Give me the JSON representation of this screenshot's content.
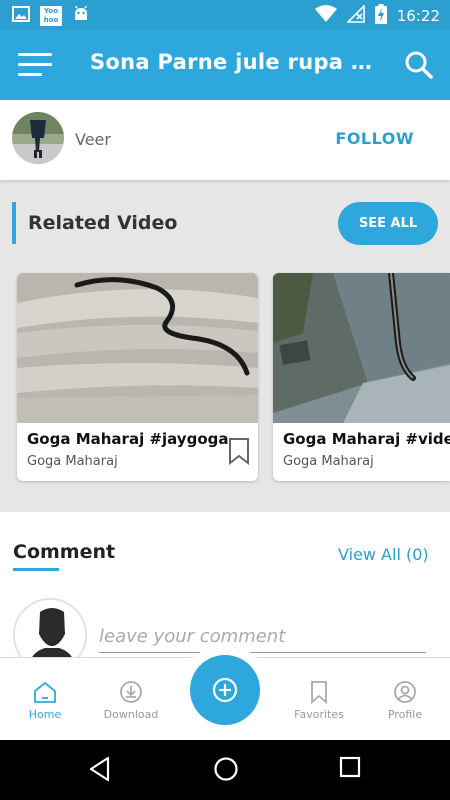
{
  "status_bar": {
    "time": "16:22",
    "left_icons": [
      "image-icon",
      "yoohoo-app-icon",
      "android-icon"
    ],
    "yoohoo_text": "Yoo hoo",
    "right_icons": [
      "wifi-icon",
      "no-signal-icon",
      "battery-charging-icon"
    ]
  },
  "app_bar": {
    "title": "Sona Parne jule rupa par...",
    "menu_icon": "hamburger-menu-icon",
    "search_icon": "search-icon"
  },
  "author": {
    "name": "Veer",
    "follow_label": "FOLLOW"
  },
  "related": {
    "title": "Related Video",
    "see_all_label": "SEE ALL",
    "videos": [
      {
        "title": "Goga Maharaj #jaygoga",
        "channel": "Goga Maharaj"
      },
      {
        "title": "Goga Maharaj #video",
        "channel": "Goga Maharaj"
      }
    ]
  },
  "comments": {
    "title": "Comment",
    "view_all_label": "View All (0)",
    "placeholder": "leave your comment"
  },
  "bottom_nav": {
    "items": [
      {
        "label": "Home",
        "icon": "home-icon",
        "active": true
      },
      {
        "label": "Download",
        "icon": "download-icon",
        "active": false
      },
      {
        "label": "Favorites",
        "icon": "bookmark-icon",
        "active": false
      },
      {
        "label": "Profile",
        "icon": "profile-icon",
        "active": false
      }
    ],
    "fab_icon": "add-circle-icon"
  },
  "colors": {
    "primary": "#2ea7dc",
    "status_bar": "#2a9fd0",
    "active_nav": "#2ea7dc",
    "inactive_nav": "#999999"
  }
}
